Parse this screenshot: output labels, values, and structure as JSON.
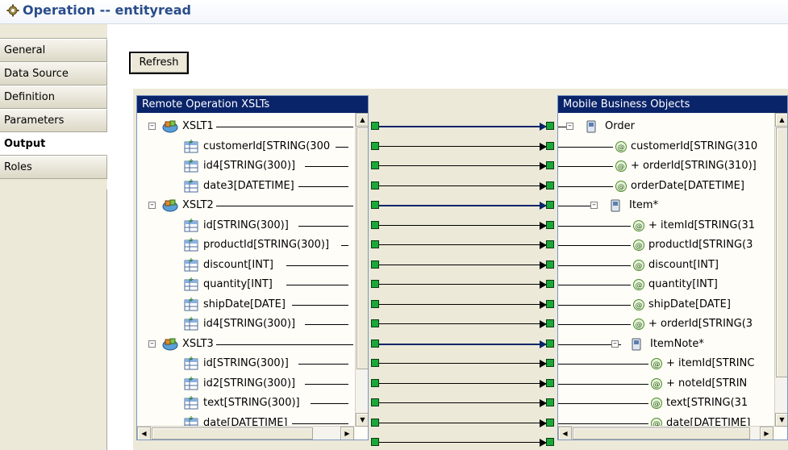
{
  "header": {
    "title": "Operation -- entityread",
    "icon": "gear-icon"
  },
  "nav": {
    "items": [
      {
        "label": "General"
      },
      {
        "label": "Data Source"
      },
      {
        "label": "Definition"
      },
      {
        "label": "Parameters"
      },
      {
        "label": "Output"
      },
      {
        "label": "Roles"
      }
    ],
    "active": "Output"
  },
  "toolbar": {
    "refresh_label": "Refresh"
  },
  "left_panel": {
    "title": "Remote Operation XSLTs",
    "rows": [
      {
        "label": "XSLT1"
      },
      {
        "label": "customerId[STRING(300"
      },
      {
        "label": "id4[STRING(300)]"
      },
      {
        "label": "date3[DATETIME]"
      },
      {
        "label": "XSLT2"
      },
      {
        "label": "id[STRING(300)]"
      },
      {
        "label": "productId[STRING(300)]"
      },
      {
        "label": "discount[INT]"
      },
      {
        "label": "quantity[INT]"
      },
      {
        "label": "shipDate[DATE]"
      },
      {
        "label": "id4[STRING(300)]"
      },
      {
        "label": "XSLT3"
      },
      {
        "label": "id[STRING(300)]"
      },
      {
        "label": "id2[STRING(300)]"
      },
      {
        "label": "text[STRING(300)]"
      },
      {
        "label": "date[DATETIME]"
      }
    ]
  },
  "right_panel": {
    "title": "Mobile Business Objects",
    "rows": [
      {
        "label": "Order"
      },
      {
        "label": "customerId[STRING(310"
      },
      {
        "label": "+ orderId[STRING(310)]"
      },
      {
        "label": "orderDate[DATETIME]"
      },
      {
        "label": "Item*"
      },
      {
        "label": "+ itemId[STRING(31"
      },
      {
        "label": "productId[STRING(3"
      },
      {
        "label": "discount[INT]"
      },
      {
        "label": "quantity[INT]"
      },
      {
        "label": "shipDate[DATE]"
      },
      {
        "label": "+ orderId[STRING(3"
      },
      {
        "label": "ItemNote*"
      },
      {
        "label": "+ itemId[STRINC"
      },
      {
        "label": "+ noteId[STRIN"
      },
      {
        "label": "text[STRING(31"
      },
      {
        "label": "date[DATETIME]"
      }
    ]
  },
  "colors": {
    "connector": "#1ca73a",
    "header_title": "#2a4d8b",
    "panel_title_bg": "#0a246a",
    "map_line_highlight": "#0a246a"
  }
}
